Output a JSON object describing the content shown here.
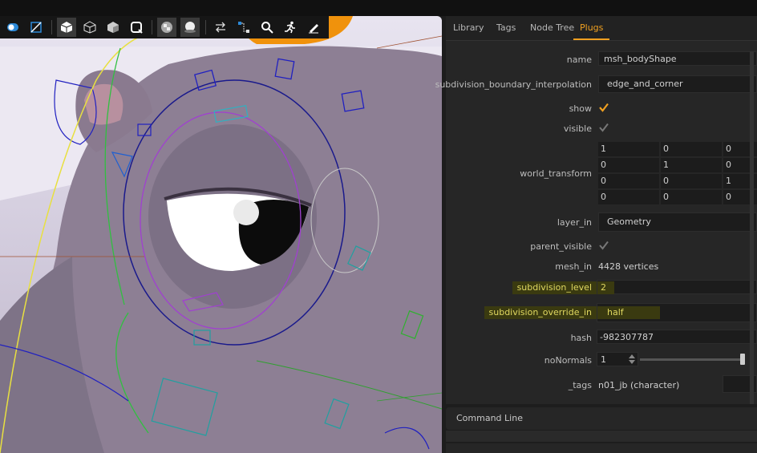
{
  "tabs": [
    "Library",
    "Tags",
    "Node Tree",
    "Plugs"
  ],
  "plugs": {
    "name_label": "name",
    "name_value": "msh_bodyShape",
    "subdiv_boundary_label": "subdivision_boundary_interpolation",
    "subdiv_boundary_value": "edge_and_corner",
    "show_label": "show",
    "visible_label": "visible",
    "world_transform_label": "world_transform",
    "world_transform": [
      [
        "1",
        "0",
        "0"
      ],
      [
        "0",
        "1",
        "0"
      ],
      [
        "0",
        "0",
        "1"
      ],
      [
        "0",
        "0",
        "0"
      ]
    ],
    "layer_in_label": "layer_in",
    "layer_in_value": "Geometry",
    "parent_visible_label": "parent_visible",
    "mesh_in_label": "mesh_in",
    "mesh_in_value": "4428 vertices",
    "subdivision_level_label": "subdivision_level",
    "subdivision_level_value": "2",
    "subdivision_override_label": "subdivision_override_in",
    "subdivision_override_value": "half",
    "hash_label": "hash",
    "hash_value": "-982307787",
    "nonormals_label": "noNormals",
    "nonormals_value": "1",
    "tags_label": "_tags",
    "tags_value": "n01_jb (character)"
  },
  "command_line": {
    "label": "Command Line"
  },
  "toolbar_icons": [
    "camera-toggle-icon",
    "fit-icon",
    "shaded-cube-icon",
    "wireframe-cube-icon",
    "lit-cube-icon",
    "cube-outline-icon",
    "checker-icon",
    "sphere-icon",
    "swap-icon",
    "nodes-icon",
    "search-icon",
    "run-icon",
    "pen-icon"
  ],
  "colors": {
    "accent": "#f0a020",
    "highlight": "#3a3a10",
    "panel_bg": "#262626"
  }
}
